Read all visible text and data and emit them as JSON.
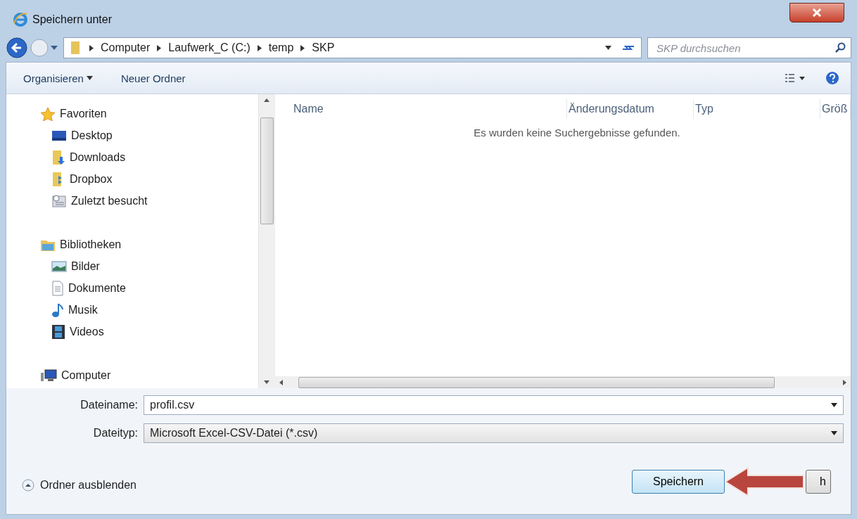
{
  "window": {
    "title": "Speichern unter"
  },
  "address_bar": {
    "breadcrumbs": [
      "Computer",
      "Laufwerk_C (C:)",
      "temp",
      "SKP"
    ]
  },
  "search": {
    "placeholder": "SKP durchsuchen"
  },
  "toolbar": {
    "buttons": [
      {
        "label": "Organisieren",
        "dropdown": true
      },
      {
        "label": "Neuer Ordner",
        "dropdown": false
      }
    ]
  },
  "sidebar": {
    "groups": [
      {
        "label": "Favoriten",
        "children": [
          {
            "label": "Desktop"
          },
          {
            "label": "Downloads"
          },
          {
            "label": "Dropbox"
          },
          {
            "label": "Zuletzt besucht"
          }
        ]
      },
      {
        "label": "Bibliotheken",
        "children": [
          {
            "label": "Bilder"
          },
          {
            "label": "Dokumente"
          },
          {
            "label": "Musik"
          },
          {
            "label": "Videos"
          }
        ]
      },
      {
        "label": "Computer"
      }
    ]
  },
  "table": {
    "columns": [
      "Name",
      "Änderungsdatum",
      "Typ",
      "Größ"
    ],
    "empty_message": "Es wurden keine Suchergebnisse gefunden."
  },
  "form": {
    "filename": {
      "label": "Dateiname:",
      "value": "profil.csv"
    },
    "filetype": {
      "label": "Dateityp:",
      "value": "Microsoft Excel-CSV-Datei (*.csv)"
    }
  },
  "footer": {
    "toggle": "Ordner ausblenden",
    "buttons": [
      {
        "label": "Speichern",
        "kind": "primary"
      },
      {
        "label": "h",
        "kind": "covered"
      }
    ]
  },
  "annotation": {
    "kind": "arrow"
  }
}
